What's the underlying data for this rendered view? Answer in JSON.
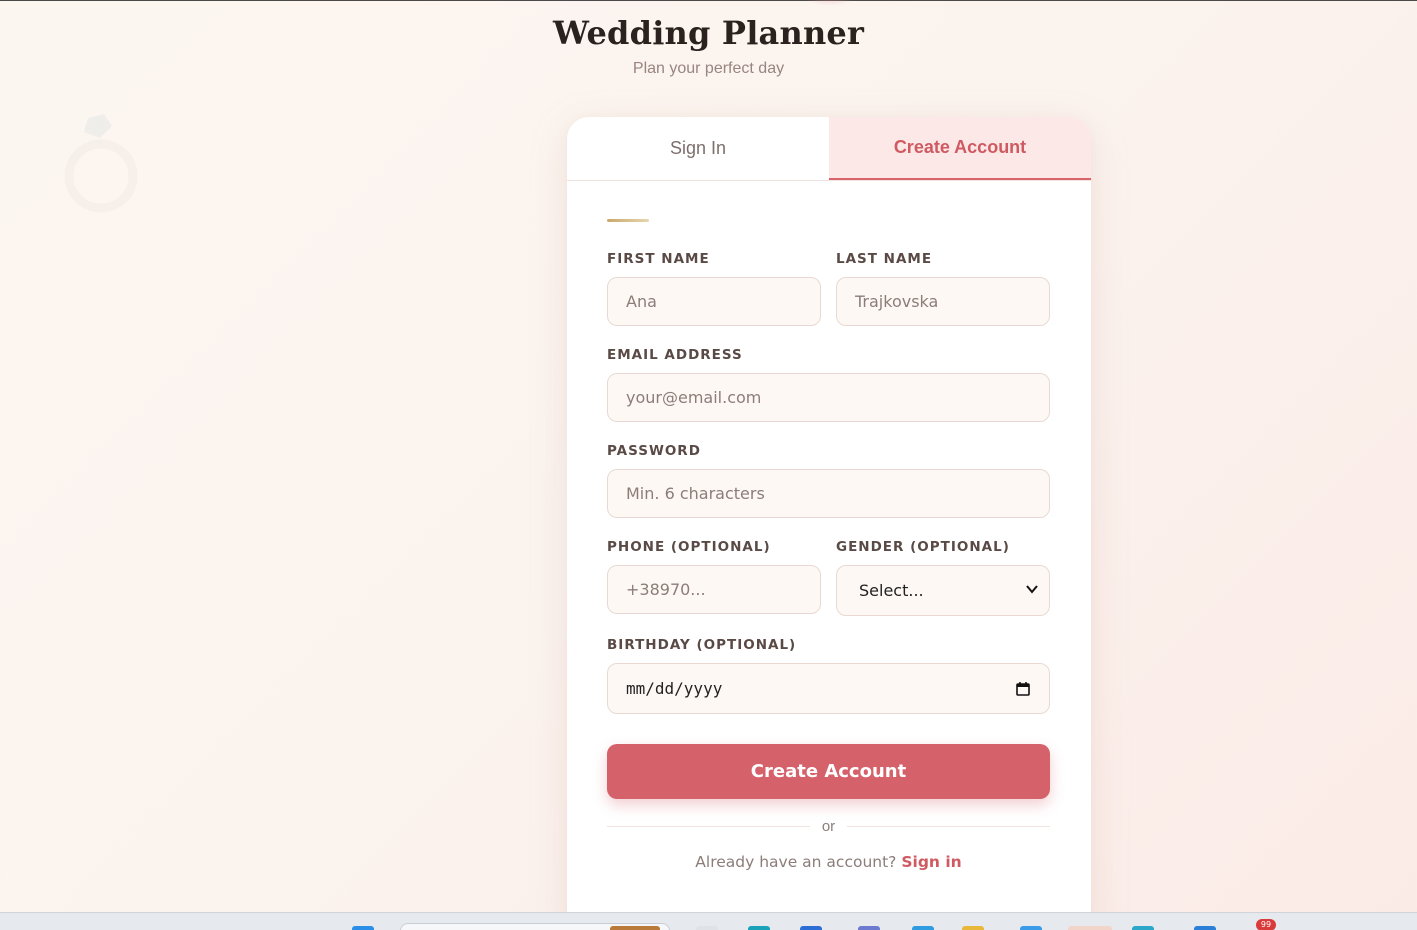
{
  "brand": {
    "title": "Wedding Planner",
    "subtitle": "Plan your perfect day"
  },
  "tabs": [
    {
      "label": "Sign In",
      "active": false
    },
    {
      "label": "Create Account",
      "active": true
    }
  ],
  "form": {
    "first_name": {
      "label": "FIRST NAME",
      "value": "",
      "placeholder": "Ana"
    },
    "last_name": {
      "label": "LAST NAME",
      "value": "",
      "placeholder": "Trajkovska"
    },
    "email": {
      "label": "EMAIL ADDRESS",
      "value": "",
      "placeholder": "your@email.com"
    },
    "password": {
      "label": "PASSWORD",
      "value": "",
      "placeholder": "Min. 6 characters"
    },
    "phone": {
      "label": "PHONE (OPTIONAL)",
      "value": "",
      "placeholder": "+38970..."
    },
    "gender": {
      "label": "GENDER (OPTIONAL)",
      "selected": "Select..."
    },
    "birthday": {
      "label": "BIRTHDAY (OPTIONAL)",
      "value": "mm/dd/yyyy"
    },
    "submit_label": "Create Account",
    "divider_text": "or",
    "switch_prompt": "Already have an account?",
    "switch_link": "Sign in"
  },
  "taskbar": {
    "notification_count": "99"
  },
  "colors": {
    "accent": "#d5616a",
    "accent_text": "#cf5a62",
    "tab_active_bg": "#fce8e6",
    "gold": "#c9a96a"
  },
  "icons": {
    "decoration": "ring-icon",
    "gender_select": "chevron-down-icon",
    "birthday": "calendar-icon"
  }
}
